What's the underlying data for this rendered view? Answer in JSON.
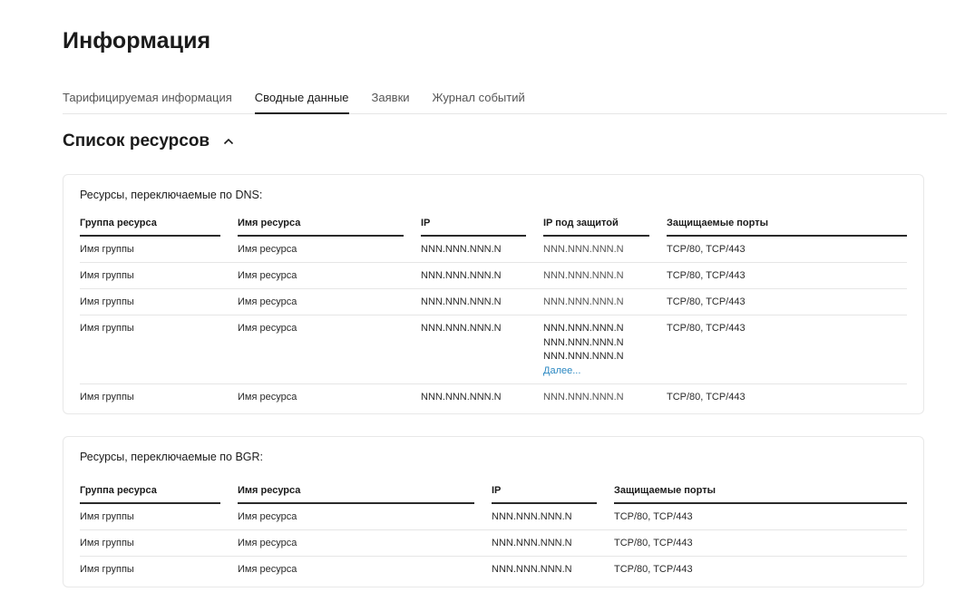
{
  "page": {
    "title": "Информация"
  },
  "tabs": [
    {
      "label": "Тарифицируемая информация"
    },
    {
      "label": "Сводные данные"
    },
    {
      "label": "Заявки"
    },
    {
      "label": "Журнал событий"
    }
  ],
  "section": {
    "title": "Список ресурсов"
  },
  "dns": {
    "title": "Ресурсы, переключаемые по DNS:",
    "headers": [
      "Группа ресурса",
      "Имя ресурса",
      "IP",
      "IP под защитой",
      "Защищаемые порты"
    ],
    "rows": [
      {
        "group": "Имя группы",
        "name": "Имя ресурса",
        "ip": "NNN.NNN.NNN.N",
        "protected_ip": [
          "NNN.NNN.NNN.N"
        ],
        "ports": "TCP/80, TCP/443"
      },
      {
        "group": "Имя группы",
        "name": "Имя ресурса",
        "ip": "NNN.NNN.NNN.N",
        "protected_ip": [
          "NNN.NNN.NNN.N"
        ],
        "ports": "TCP/80, TCP/443"
      },
      {
        "group": "Имя группы",
        "name": "Имя ресурса",
        "ip": "NNN.NNN.NNN.N",
        "protected_ip": [
          "NNN.NNN.NNN.N"
        ],
        "ports": "TCP/80, TCP/443"
      },
      {
        "group": "Имя группы",
        "name": "Имя ресурса",
        "ip": "NNN.NNN.NNN.N",
        "protected_ip": [
          "NNN.NNN.NNN.N",
          "NNN.NNN.NNN.N",
          "NNN.NNN.NNN.N"
        ],
        "more": "Далее...",
        "ports": "TCP/80, TCP/443"
      },
      {
        "group": "Имя группы",
        "name": "Имя ресурса",
        "ip": "NNN.NNN.NNN.N",
        "protected_ip": [
          "NNN.NNN.NNN.N"
        ],
        "ports": "TCP/80, TCP/443"
      }
    ]
  },
  "bgr": {
    "title": "Ресурсы, переключаемые по BGR:",
    "headers": [
      "Группа ресурса",
      "Имя ресурса",
      "IP",
      "Защищаемые порты"
    ],
    "rows": [
      {
        "group": "Имя группы",
        "name": "Имя ресурса",
        "ip": "NNN.NNN.NNN.N",
        "ports": "TCP/80, TCP/443"
      },
      {
        "group": "Имя группы",
        "name": "Имя ресурса",
        "ip": "NNN.NNN.NNN.N",
        "ports": "TCP/80, TCP/443"
      },
      {
        "group": "Имя группы",
        "name": "Имя ресурса",
        "ip": "NNN.NNN.NNN.N",
        "ports": "TCP/80, TCP/443"
      }
    ]
  },
  "colors": {
    "link": "#2b88c2",
    "text": "#1b1b1b",
    "divider": "#e6e6e6"
  },
  "icons": {
    "section_toggle": "chevron-up-icon"
  }
}
